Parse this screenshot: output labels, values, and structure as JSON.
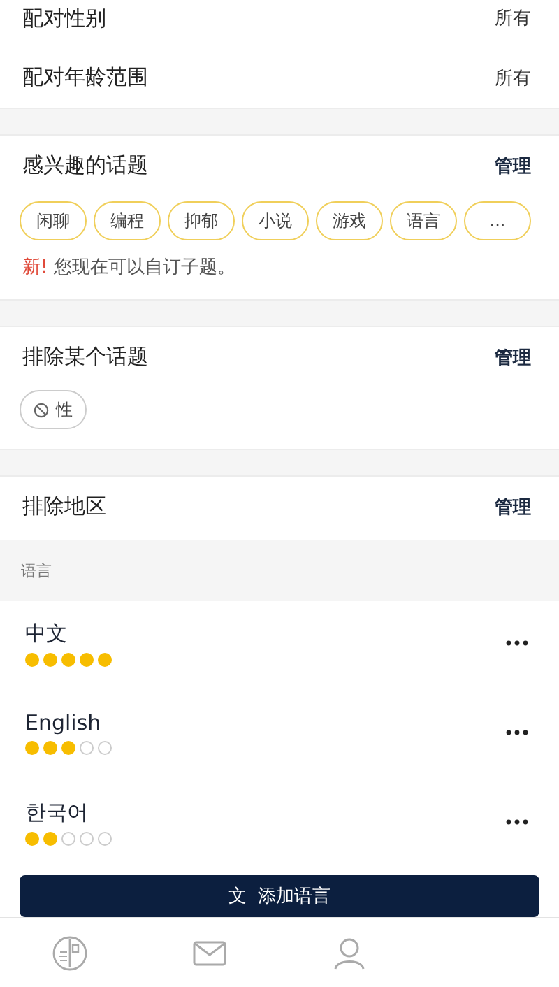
{
  "match_settings": [
    {
      "label": "配对性别",
      "value": "所有"
    },
    {
      "label": "配对年龄范围",
      "value": "所有"
    }
  ],
  "interest_topics": {
    "title": "感兴趣的话题",
    "action": "管理",
    "tags": [
      "闲聊",
      "编程",
      "抑郁",
      "小说",
      "游戏",
      "语言",
      "..."
    ],
    "notice": {
      "badge": "新!",
      "text": "您现在可以自订子题。"
    }
  },
  "excluded_topics": {
    "title": "排除某个话题",
    "action": "管理",
    "tags": [
      "性"
    ]
  },
  "excluded_regions": {
    "title": "排除地区",
    "action": "管理"
  },
  "languages": {
    "header": "语言",
    "items": [
      {
        "name": "中文",
        "stars": 5
      },
      {
        "name": "English",
        "stars": 3
      },
      {
        "name": "한국어",
        "stars": 2
      }
    ],
    "add_button": {
      "icon": "文",
      "label": "添加语言"
    }
  },
  "tab_bar": [
    {
      "kind": "card"
    },
    {
      "kind": "mail"
    },
    {
      "kind": "person"
    }
  ]
}
